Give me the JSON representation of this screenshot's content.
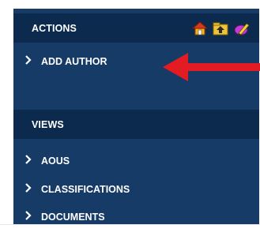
{
  "actions": {
    "title": "ACTIONS",
    "icons": [
      "home-icon",
      "folder-up-icon",
      "edit-pencil-icon"
    ],
    "items": [
      {
        "label": "ADD AUTHOR"
      }
    ]
  },
  "views": {
    "title": "VIEWS",
    "items": [
      {
        "label": "AOUS"
      },
      {
        "label": "CLASSIFICATIONS"
      },
      {
        "label": "DOCUMENTS"
      }
    ]
  },
  "annotation": {
    "arrow_color": "#e31b23",
    "points_to": "ADD AUTHOR"
  },
  "colors": {
    "panel_bg": "#153b66",
    "header_bg": "#0b2a4d",
    "text": "#ffffff"
  }
}
